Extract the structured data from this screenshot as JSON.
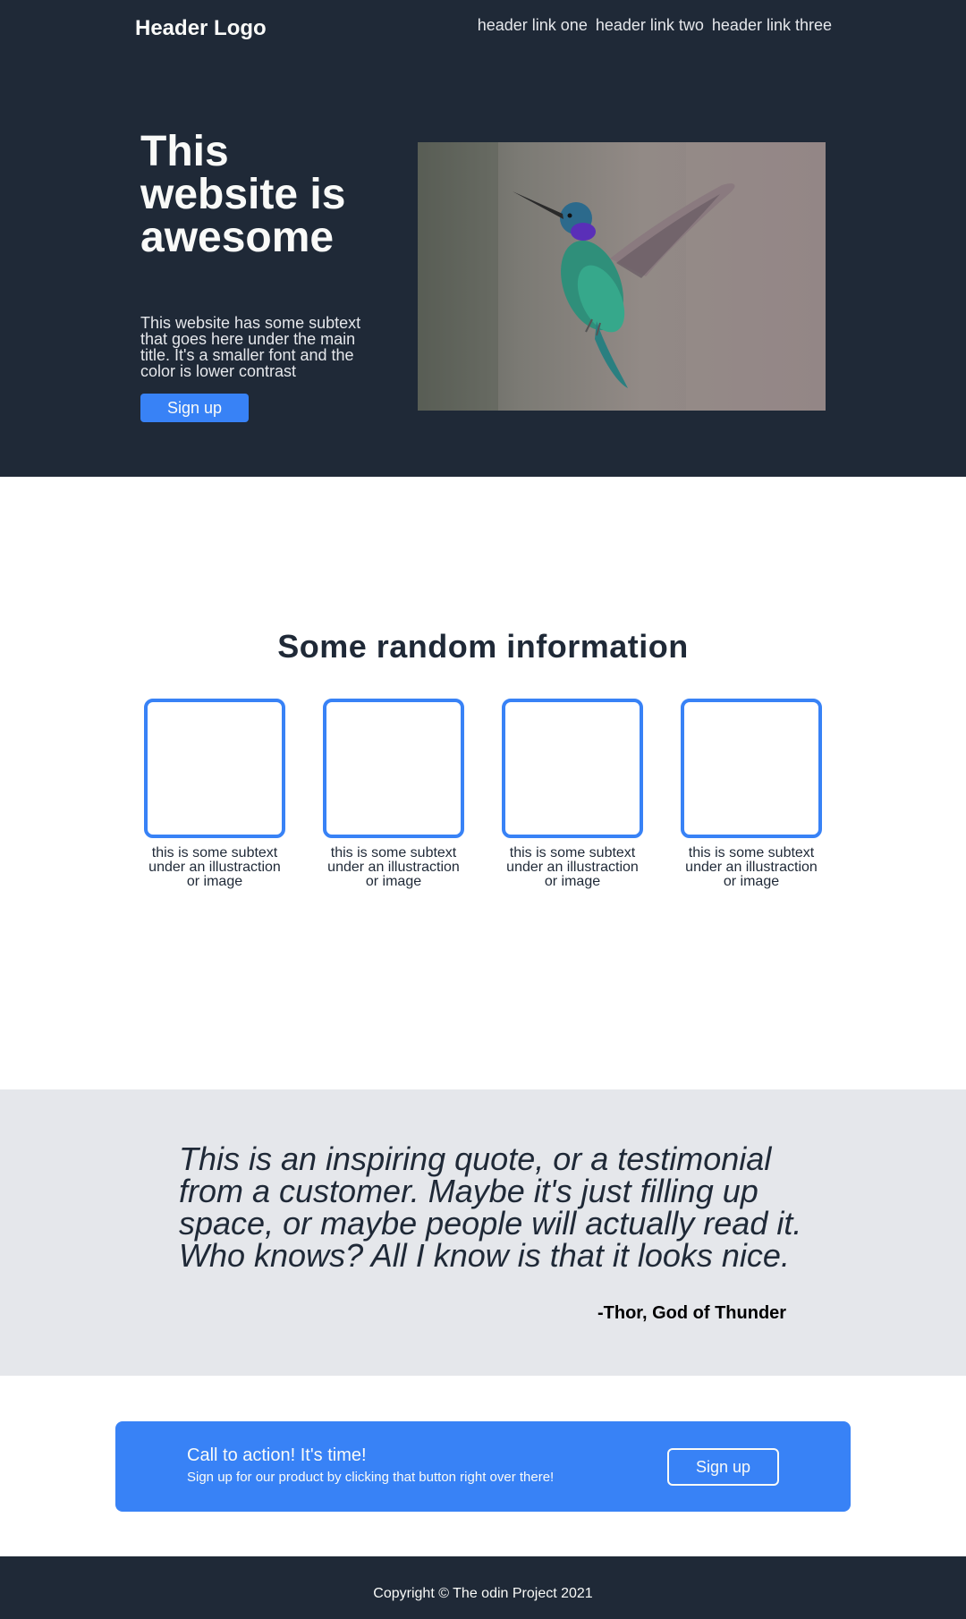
{
  "header": {
    "logo": "Header Logo",
    "links": [
      "header link one",
      "header link two",
      "header link three"
    ]
  },
  "hero": {
    "title": "This website is awesome",
    "subtext": "This website has some subtext that goes here under the main title. It's a smaller font and the color is lower contrast",
    "button_label": "Sign up",
    "image_icon": "hummingbird-image"
  },
  "info": {
    "title": "Some random information",
    "cards": [
      {
        "caption": "this is some subtext under an illustraction or image"
      },
      {
        "caption": "this is some subtext under an illustraction or image"
      },
      {
        "caption": "this is some subtext under an illustraction or image"
      },
      {
        "caption": "this is some subtext under an illustraction or image"
      }
    ]
  },
  "quote": {
    "text": "This is an inspiring quote, or a testimonial from a customer. Maybe it's just filling up space, or maybe people will actually read it. Who knows? All I know is that it looks nice.",
    "author": "-Thor, God of Thunder"
  },
  "cta": {
    "title": "Call to action! It's time!",
    "subtext": "Sign up for our product by clicking that button right over there!",
    "button_label": "Sign up"
  },
  "footer": {
    "copyright": "Copyright © The odin Project 2021"
  },
  "colors": {
    "dark": "#1f2937",
    "accent": "#3882f6",
    "light_text": "#f9faf8",
    "muted_text": "#e5e7eb",
    "quote_bg": "#e5e7eb"
  }
}
